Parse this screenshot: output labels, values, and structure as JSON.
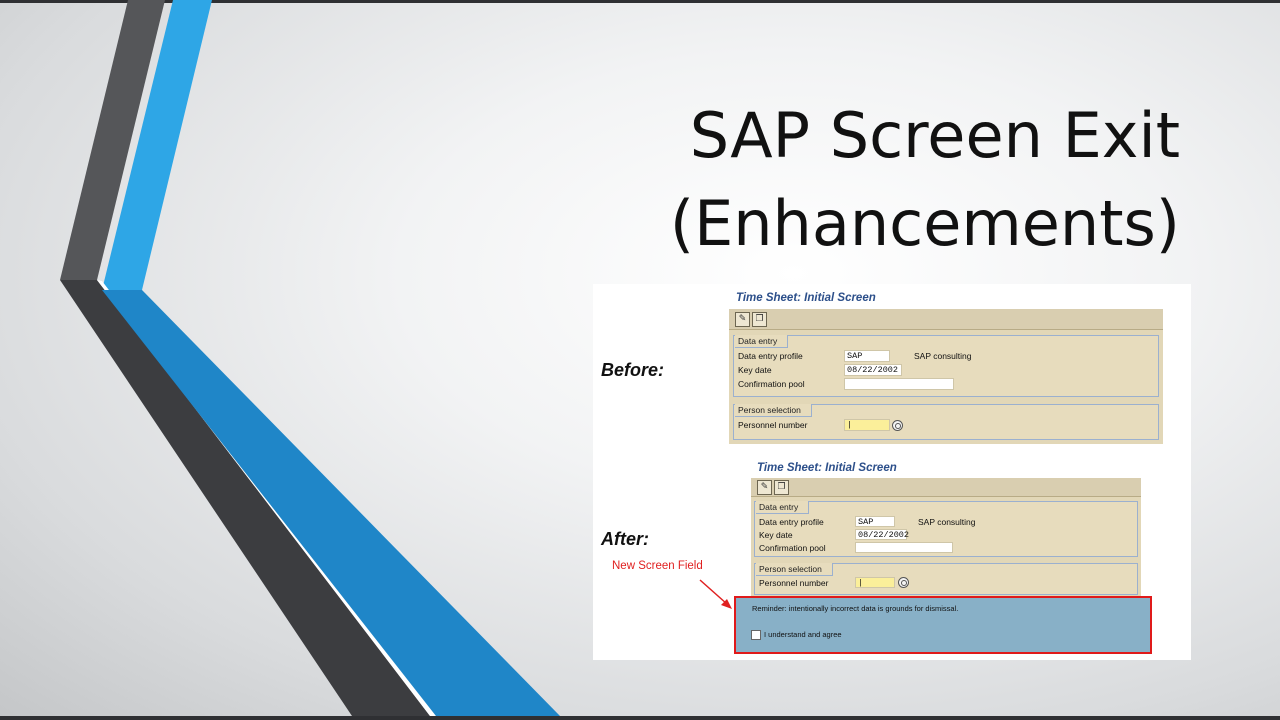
{
  "slide": {
    "title_line1": "SAP Screen Exit",
    "title_line2": "(Enhancements)"
  },
  "figure": {
    "before_label": "Before:",
    "after_label": "After:",
    "screen_title": "Time Sheet: Initial Screen",
    "data_entry_group": "Data entry",
    "person_selection_group": "Person selection",
    "fields": {
      "profile_label": "Data entry profile",
      "profile_value": "SAP",
      "profile_desc": "SAP consulting",
      "key_date_label": "Key date",
      "key_date_value": "08/22/2002",
      "confirmation_pool_label": "Confirmation pool",
      "personnel_number_label": "Personnel number",
      "personnel_number_value": "|"
    },
    "toolbar_icons": [
      "pencil-icon",
      "copy-icon"
    ],
    "new_field_note": "New Screen Field",
    "reminder_text": "Reminder: intentionally incorrect data is grounds for dismissal.",
    "agree_label": "I understand and agree",
    "colors": {
      "accent_blue": "#2ea6e6",
      "dark_band": "#3c3d40",
      "highlight_red": "#e01a1a",
      "sap_title_blue": "#2c4f8a",
      "new_field_bg": "#88b0c7"
    }
  }
}
